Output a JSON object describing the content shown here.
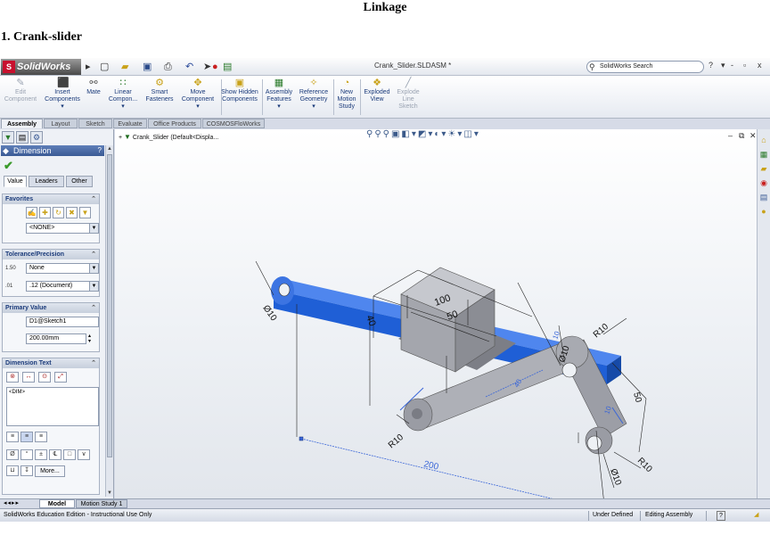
{
  "document": {
    "title": "Linkage",
    "heading": "1. Crank-slider"
  },
  "app": {
    "logo": "SolidWorks",
    "file_name": "Crank_Slider.SLDASM *",
    "search_placeholder": "SolidWorks Search",
    "help": "?",
    "min": "-",
    "restore": "▫",
    "close": "x"
  },
  "commands": [
    {
      "label": "Edit Component",
      "icon": "edit-component-icon",
      "glyph": "✎",
      "enabled": false
    },
    {
      "label": "Insert Components",
      "icon": "insert-components-icon",
      "glyph": "⬛",
      "enabled": true
    },
    {
      "label": "Mate",
      "icon": "mate-icon",
      "glyph": "⚯",
      "enabled": true
    },
    {
      "label": "Linear Compon...",
      "icon": "linear-pattern-icon",
      "glyph": "∷",
      "enabled": true
    },
    {
      "label": "Smart Fasteners",
      "icon": "smart-fasteners-icon",
      "glyph": "⚙",
      "enabled": true
    },
    {
      "label": "Move Component",
      "icon": "move-component-icon",
      "glyph": "✥",
      "enabled": true
    },
    {
      "label": "Show Hidden Components",
      "icon": "show-hidden-icon",
      "glyph": "▣",
      "enabled": true
    },
    {
      "label": "Assembly Features",
      "icon": "assembly-features-icon",
      "glyph": "▦",
      "enabled": true
    },
    {
      "label": "Reference Geometry",
      "icon": "reference-geometry-icon",
      "glyph": "✧",
      "enabled": true
    },
    {
      "label": "New Motion Study",
      "icon": "motion-study-icon",
      "glyph": "◔",
      "enabled": true
    },
    {
      "label": "Exploded View",
      "icon": "exploded-view-icon",
      "glyph": "❖",
      "enabled": true
    },
    {
      "label": "Explode Line Sketch",
      "icon": "explode-line-icon",
      "glyph": "╱",
      "enabled": false
    }
  ],
  "tabs": [
    "Assembly",
    "Layout",
    "Sketch",
    "Evaluate",
    "Office Products",
    "COSMOSFloWorks"
  ],
  "property_manager": {
    "title": "Dimension",
    "help": "?",
    "subtabs": [
      "Value",
      "Leaders",
      "Other"
    ],
    "favorites": {
      "title": "Favorites",
      "selected": "<NONE>"
    },
    "tolerance": {
      "title": "Tolerance/Precision",
      "tolerance_type": "None",
      "precision": ".12 (Document)",
      "tol_icon_text": "1.50",
      "prec_icon_text": ".01"
    },
    "primary_value": {
      "title": "Primary Value",
      "name": "D1@Sketch1",
      "value": "200.00mm"
    },
    "dimension_text": {
      "title": "Dimension Text",
      "text": "<DIM>",
      "more": "More..."
    }
  },
  "viewport": {
    "tree_label": "Crank_Slider  (Default<Displa..."
  },
  "drawing": {
    "dim_100": "100",
    "dim_50_top": "50",
    "dim_40": "40",
    "dim_diam10_left": "Ø10",
    "dim_diam10_top": "Ø10",
    "dim_r10_top": "R10",
    "dim_50_right": "50",
    "dim_r10_bottom_left": "R10",
    "dim_r10_bottom_right": "R10",
    "dim_diam10_bottom": "Ø10",
    "dim_200": "200",
    "dim_40_link": "40",
    "dim_10_a": "10",
    "dim_10_b": "10",
    "axis_x": "x",
    "axis_y": "y",
    "axis_z": "z",
    "colors": {
      "slider_bar": "#1f5fd6",
      "block": "#a4a6ad",
      "link": "#9a9ca4",
      "selected_dim": "#3a66d8"
    }
  },
  "bottom_tabs": [
    "Model",
    "Motion Study 1"
  ],
  "status": {
    "edition": "SolidWorks Education Edition - Instructional Use Only",
    "defined": "Under Defined",
    "mode": "Editing Assembly",
    "help": "?"
  }
}
